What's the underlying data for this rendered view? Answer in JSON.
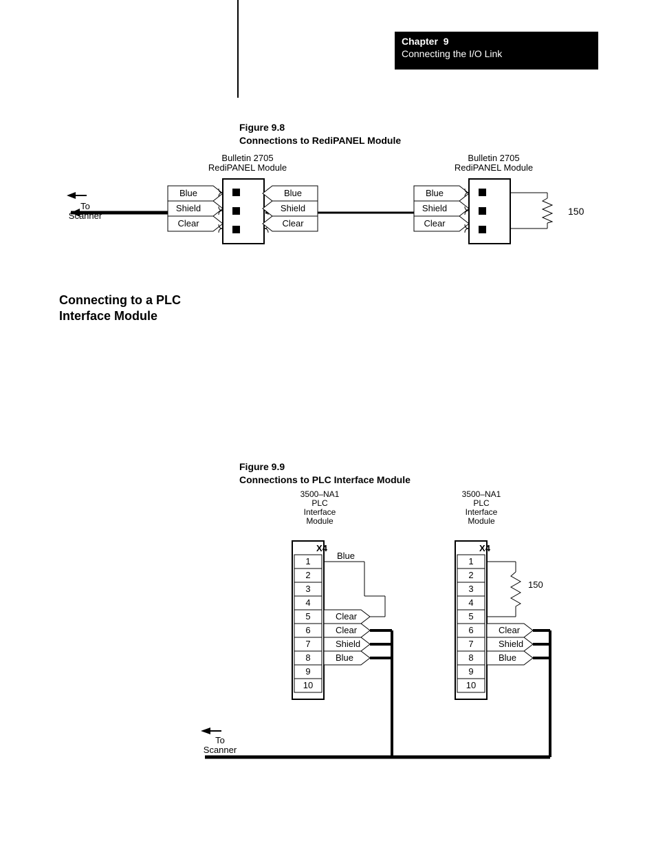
{
  "header": {
    "chapter_label": "Chapter",
    "chapter_num": "9",
    "subtitle": "Connecting the I/O Link"
  },
  "section_heading": {
    "l1": "Connecting to a PLC",
    "l2": "Interface Module"
  },
  "fig98": {
    "num": "Figure 9.8",
    "title": "Connections to RediPANEL Module",
    "module_label_l1": "Bulletin 2705",
    "module_label_l2": "RediPANEL Module",
    "wires": {
      "a": "Blue",
      "b": "Shield",
      "c": "Clear"
    },
    "to_l1": "To",
    "to_l2": "Scanner",
    "term": "150"
  },
  "fig99": {
    "num": "Figure 9.9",
    "title": "Connections to PLC Interface Module",
    "module_label": {
      "l1": "3500–NA1",
      "l2": "PLC",
      "l3": "Interface",
      "l4": "Module"
    },
    "header": "X4",
    "pins": [
      "1",
      "2",
      "3",
      "4",
      "5",
      "6",
      "7",
      "8",
      "9",
      "10"
    ],
    "labels": {
      "blue": "Blue",
      "clear": "Clear",
      "shield": "Shield"
    },
    "term": "150",
    "to_l1": "To",
    "to_l2": "Scanner"
  }
}
